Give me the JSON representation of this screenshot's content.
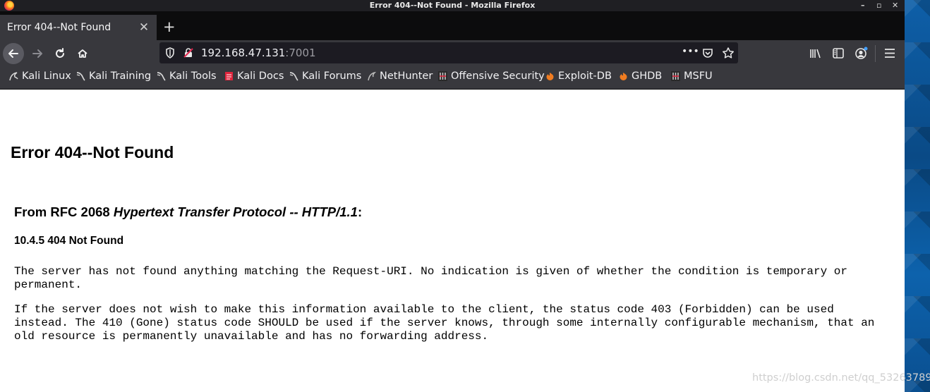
{
  "window": {
    "title": "Error 404--Not Found - Mozilla Firefox",
    "controls": {
      "minimize": "–",
      "maximize": "▫",
      "close": "✕"
    }
  },
  "tabs": [
    {
      "label": "Error 404--Not Found",
      "close": "✕"
    }
  ],
  "new_tab_label": "+",
  "navbar": {
    "url_host": "192.168.47.131",
    "url_port": ":7001",
    "page_actions": "•••"
  },
  "bookmarks": [
    {
      "label": "Kali Linux",
      "icon": "kali-dragon-icon"
    },
    {
      "label": "Kali Training",
      "icon": "kali-dragon-icon"
    },
    {
      "label": "Kali Tools",
      "icon": "kali-dragon-icon"
    },
    {
      "label": "Kali Docs",
      "icon": "kali-docs-icon"
    },
    {
      "label": "Kali Forums",
      "icon": "kali-dragon-icon"
    },
    {
      "label": "NetHunter",
      "icon": "nethunter-icon"
    },
    {
      "label": "Offensive Security",
      "icon": "offsec-icon"
    },
    {
      "label": "Exploit-DB",
      "icon": "exploitdb-icon"
    },
    {
      "label": "GHDB",
      "icon": "exploitdb-icon"
    },
    {
      "label": "MSFU",
      "icon": "offsec-icon"
    }
  ],
  "page": {
    "heading": "Error 404--Not Found",
    "rfc_prefix": "From RFC 2068 ",
    "rfc_title": "Hypertext Transfer Protocol -- HTTP/1.1",
    "rfc_suffix": ":",
    "section": "10.4.5 404 Not Found",
    "paragraph1": "The server has not found anything matching the Request-URI. No indication is given of whether the condition is temporary or permanent.",
    "paragraph2": "If the server does not wish to make this information available to the client, the status code 403 (Forbidden) can be used instead. The 410 (Gone) status code SHOULD be used if the server knows, through some internally configurable mechanism, that an old resource is permanently unavailable and has no forwarding address."
  },
  "watermark": "https://blog.csdn.net/qq_53263789",
  "colors": {
    "chrome_dark": "#0c0c0d",
    "toolbar": "#38383d",
    "urlbar": "#1c1b22",
    "desktop_accent": "#0e5fa8"
  }
}
